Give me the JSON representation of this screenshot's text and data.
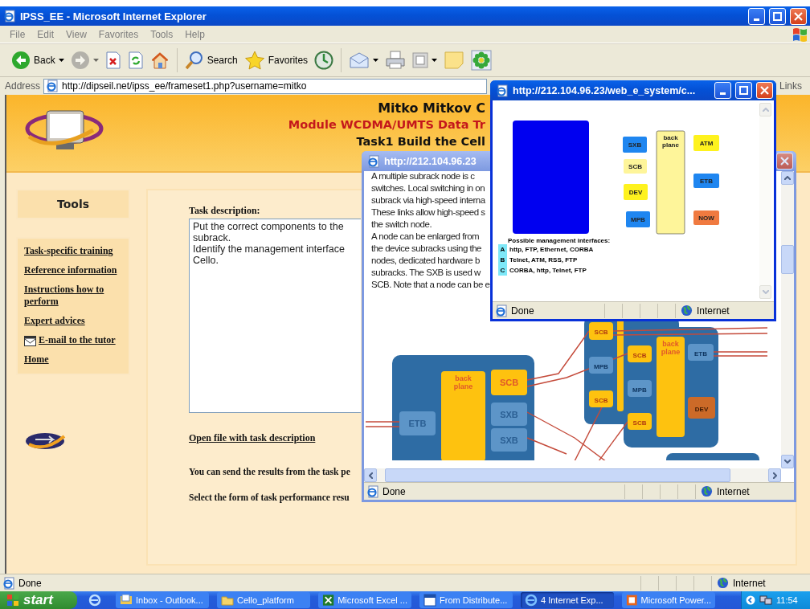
{
  "window": {
    "title": "IPSS_EE - Microsoft Internet Explorer"
  },
  "menu": [
    "File",
    "Edit",
    "View",
    "Favorites",
    "Tools",
    "Help"
  ],
  "toolbar": [
    {
      "kind": "back",
      "label": "Back",
      "disabled": false,
      "dropdown": true
    },
    {
      "kind": "forward",
      "disabled": true,
      "dropdown": true
    },
    {
      "kind": "stop",
      "disabled": false,
      "dropdown": false
    },
    {
      "kind": "refresh",
      "disabled": false,
      "dropdown": false
    },
    {
      "kind": "home",
      "disabled": false,
      "dropdown": false
    },
    {
      "kind": "search",
      "label": "Search",
      "disabled": false,
      "dropdown": false
    },
    {
      "kind": "favorites",
      "label": "Favorites",
      "disabled": false,
      "dropdown": false
    },
    {
      "kind": "media",
      "disabled": false,
      "dropdown": false
    },
    {
      "kind": "mail",
      "disabled": false,
      "dropdown": true
    },
    {
      "kind": "print",
      "disabled": false,
      "dropdown": false
    },
    {
      "kind": "window",
      "disabled": false,
      "dropdown": true
    },
    {
      "kind": "note",
      "disabled": false,
      "dropdown": false
    },
    {
      "kind": "flower",
      "disabled": false,
      "dropdown": false
    }
  ],
  "address": {
    "label": "Address",
    "value": "http://dipseil.net/ipss_ee/frameset1.php?username=mitko",
    "links": "Links"
  },
  "page": {
    "header": [
      "Mitko Mitkov C",
      "Module WCDMA/UMTS Data Tr",
      "Task1 Build the Cell"
    ],
    "tools_title": "Tools",
    "nav": [
      {
        "kind": "link",
        "label": "Task-specific training"
      },
      {
        "kind": "link",
        "label": "Reference information"
      },
      {
        "kind": "link",
        "label": "Instructions how to perform"
      },
      {
        "kind": "link",
        "label": "Expert advices"
      },
      {
        "kind": "mail",
        "label": "E-mail to the tutor"
      },
      {
        "kind": "link",
        "label": "Home"
      }
    ],
    "task_label": "Task description:",
    "task_text": "Put the correct components to the\nsubrack.\nIdentify the management interface\nCello.",
    "open_link": "Open file with task description",
    "send_text": "You can send the results from the task pe",
    "select_text": "Select the form of task performance resu"
  },
  "popups": [
    {
      "title": "http://212.104.96.23",
      "active": false,
      "text": [
        "A multiple subrack node is c",
        "switches. Local switching in on",
        "subrack via high-speed interna",
        "These links allow high-speed s",
        "the switch node.",
        "A node can be enlarged from",
        "the device subracks using the",
        "nodes, dedicated hardware b",
        "subracks. The SXB is used w",
        "SCB. Note that a node can be e"
      ],
      "diagram": [
        "back plane",
        "SCB",
        "SXB",
        "SXB",
        "ETB",
        "SCB",
        "MPB",
        "SCB",
        "SCB",
        "MPB",
        "SCB",
        "back plane",
        "ETB",
        "DEV"
      ],
      "status": {
        "text": "Done",
        "zone": "Internet"
      }
    },
    {
      "title": "http://212.104.96.23/web_e_system/c...",
      "active": true,
      "components": [
        "SXB",
        "SCB",
        "DEV",
        "MPB",
        "back plane",
        "ATM",
        "ETB",
        "NOW"
      ],
      "legend": {
        "title": "Possible management interfaces:",
        "options": [
          {
            "letter": "A",
            "text": "http, FTP, Ethernet, CORBA"
          },
          {
            "letter": "B",
            "text": "Telnet, ATM, RSS, FTP"
          },
          {
            "letter": "C",
            "text": "CORBA, http, Telnet, FTP"
          }
        ]
      },
      "status": {
        "text": "Done",
        "zone": "Internet"
      }
    }
  ],
  "status_bar": {
    "text": "Done",
    "zone": "Internet"
  },
  "taskbar": {
    "start": "start",
    "tasks": [
      {
        "label": "Inbox - Outlook...",
        "selected": false
      },
      {
        "label": "Cello_platform",
        "selected": false
      },
      {
        "label": "Microsoft Excel ...",
        "selected": false
      },
      {
        "label": "From Distribute...",
        "selected": false
      },
      {
        "label": "4 Internet Exp...",
        "selected": true
      },
      {
        "label": "Microsoft Power...",
        "selected": false
      }
    ],
    "clock": "11:54"
  }
}
